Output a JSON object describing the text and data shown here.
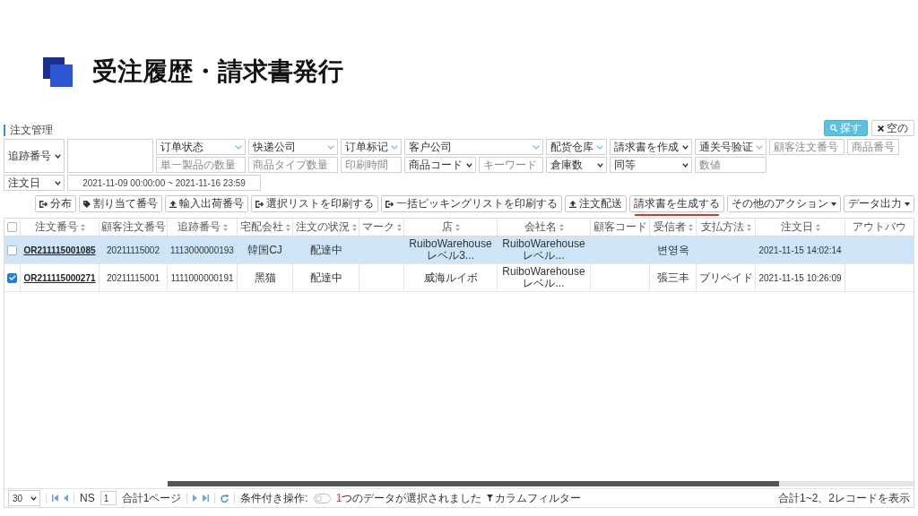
{
  "heading": {
    "title": "受注履歴・請求書発行"
  },
  "panel": {
    "title": "注文管理",
    "actions": [
      {
        "kind": "search",
        "label": "探す"
      },
      {
        "kind": "clear",
        "label": "空の"
      }
    ]
  },
  "filters": {
    "lookup": {
      "kind": "select",
      "value": "追跡番号"
    },
    "row_1": [
      {
        "kind": "multiselect",
        "value": "订单状态"
      },
      {
        "kind": "multiselect",
        "value": "快递公司"
      },
      {
        "kind": "multiselect",
        "value": "订单标记"
      },
      {
        "kind": "multiselect",
        "value": "客户公司"
      },
      {
        "kind": "multiselect",
        "value": "配货仓库"
      },
      {
        "kind": "select",
        "value": "請求書を作成"
      },
      {
        "kind": "multiselect",
        "value": "通关号验证"
      },
      {
        "kind": "input",
        "placeholder": "顧客注文番号"
      },
      {
        "kind": "input",
        "placeholder": "商品番号"
      }
    ],
    "row_2": [
      {
        "kind": "input",
        "placeholder": "単一製品の数量"
      },
      {
        "kind": "input",
        "placeholder": "商品タイプ数量"
      },
      {
        "kind": "input",
        "placeholder": "印刷時間"
      },
      {
        "kind": "select",
        "value": "商品コード"
      },
      {
        "kind": "input",
        "placeholder": "キーワード"
      },
      {
        "kind": "select",
        "value": "倉庫数"
      },
      {
        "kind": "select",
        "value": "同等"
      },
      {
        "kind": "input",
        "placeholder": "数値"
      }
    ],
    "date_type": {
      "kind": "select",
      "value": "注文日"
    },
    "date_range": {
      "value": "2021-11-09 00:00:00 ~ 2021-11-16 23:59"
    }
  },
  "toolbar": [
    {
      "kind": "exit",
      "label": "分布",
      "highlighted": false
    },
    {
      "kind": "tag",
      "label": "割り当て番号",
      "highlighted": false
    },
    {
      "kind": "upload",
      "label": "輸入出荷番号",
      "highlighted": false
    },
    {
      "kind": "exit",
      "label": "選択リストを印刷する",
      "highlighted": false
    },
    {
      "kind": "exit",
      "label": "一括ピッキングリストを印刷する",
      "highlighted": false
    },
    {
      "kind": "upload",
      "label": "注文配送",
      "highlighted": false
    },
    {
      "kind": "plain",
      "label": "請求書を生成する",
      "highlighted": true
    },
    {
      "kind": "dropdown",
      "label": "その他のアクション",
      "highlighted": false
    },
    {
      "kind": "dropdown",
      "label": "データ出力",
      "highlighted": false
    }
  ],
  "table": {
    "select_all": {
      "checked": false
    },
    "columns": [
      {
        "label": "注文番号",
        "sortable": true
      },
      {
        "label": "顧客注文番号",
        "sortable": false
      },
      {
        "label": "追跡番号",
        "sortable": true
      },
      {
        "label": "宅配会社",
        "sortable": true
      },
      {
        "label": "注文の状況",
        "sortable": true
      },
      {
        "label": "マーク",
        "sortable": true
      },
      {
        "label": "店",
        "sortable": true
      },
      {
        "label": "会社名",
        "sortable": true
      },
      {
        "label": "顧客コード",
        "sortable": false
      },
      {
        "label": "受信者",
        "sortable": true
      },
      {
        "label": "支払方法",
        "sortable": true
      },
      {
        "label": "注文日",
        "sortable": true
      },
      {
        "label": "アウトバウ",
        "sortable": false
      }
    ],
    "rows": [
      {
        "selected": true,
        "checked": false,
        "cells": [
          "OR211115001085",
          "20211115002",
          "1113000000193",
          "韓国CJ",
          "配達中",
          "",
          "RuiboWarehouseレベル3...",
          "RuiboWarehouseレベル...",
          "",
          "변영옥",
          "",
          "2021-11-15 14:02:14",
          ""
        ]
      },
      {
        "selected": false,
        "checked": true,
        "cells": [
          "OR211115000271",
          "20211115001",
          "1111000000191",
          "黑猫",
          "配達中",
          "",
          "威海ルイボ",
          "RuiboWarehouseレベル...",
          "",
          "張三丰",
          "プリペイド",
          "2021-11-15 10:26:09",
          ""
        ]
      }
    ]
  },
  "footer": {
    "page_size": {
      "value": "30"
    },
    "page_prefix": "NS",
    "page_number": {
      "value": "1"
    },
    "page_total": "合計1ページ",
    "conditional_label": "条件付き操作:",
    "conditional_toggle": {
      "on": false
    },
    "selection_count": "1",
    "selection_message": "つのデータが選択されました",
    "column_filter": "カラムフィルター",
    "summary": "合計1~2、2レコードを表示"
  }
}
